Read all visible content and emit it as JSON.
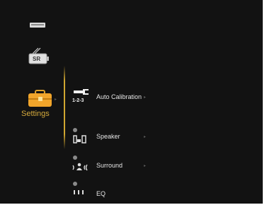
{
  "categories": [
    {
      "name": "video-icon"
    },
    {
      "name": "sr-icon",
      "badge": "SR"
    },
    {
      "name": "settings-icon",
      "label": "Settings"
    }
  ],
  "menu": {
    "items": [
      {
        "label": "Auto Calibration",
        "icon_text": "1-2-3",
        "arrow": "▸"
      },
      {
        "label": "Speaker",
        "arrow": "▸"
      },
      {
        "label": "Surround",
        "arrow": "▸"
      },
      {
        "label": "EQ"
      }
    ]
  },
  "colors": {
    "background": "#121212",
    "accent": "#d0a630",
    "text": "#e6e6e6"
  }
}
